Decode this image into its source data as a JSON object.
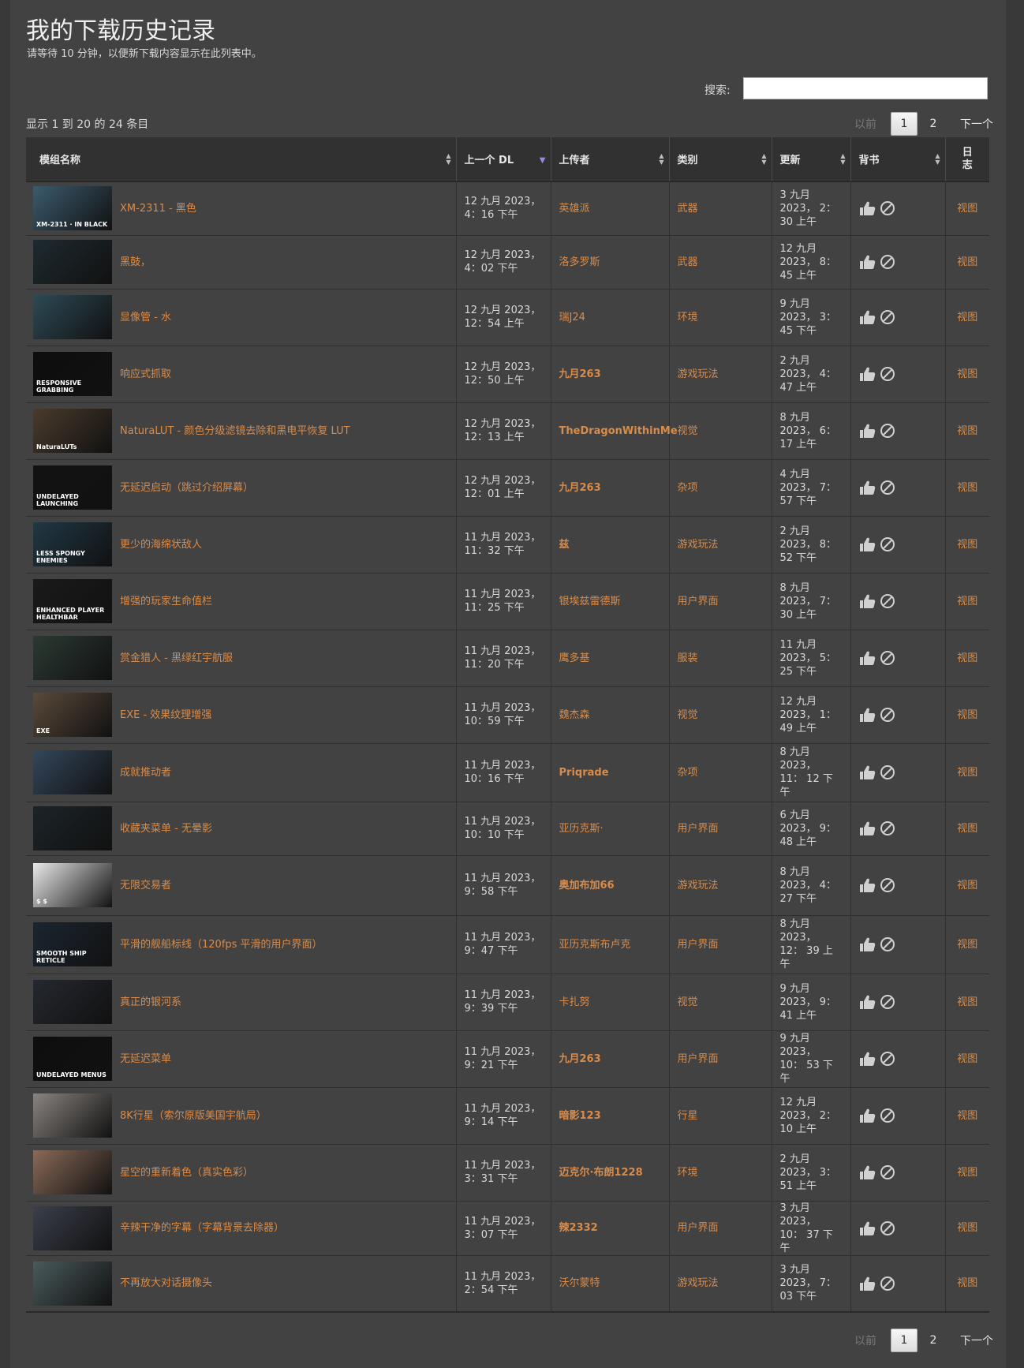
{
  "page": {
    "title": "我的下载历史记录",
    "subtitle": "请等待 10 分钟，以便新下载内容显示在此列表中。"
  },
  "search": {
    "label": "搜索:",
    "value": ""
  },
  "info": "显示 1 到 20 的 24 条目",
  "pagination": {
    "prev": "以前",
    "current": "1",
    "page2": "2",
    "next": "下一个"
  },
  "table": {
    "headers": {
      "mod": "模组名称",
      "last_dl": "上一个 DL",
      "uploader": "上传者",
      "category": "类别",
      "updated": "更新",
      "endorse": "背书",
      "log": "日志"
    },
    "rows": [
      {
        "name": "XM-2311 - 黑色",
        "dl": "12 九月 2023， 4：16 下午",
        "uploader": "英雄派",
        "category": "武器",
        "updated": "3 九月 2023， 2： 30 上午",
        "log": "视图",
        "thumb_color": "#3b5b6d",
        "thumb_text": "XM-2311 · IN BLACK",
        "uploader_bold": false
      },
      {
        "name": "黑鼓，",
        "dl": "12 九月 2023， 4：02 下午",
        "uploader": "洛多罗斯",
        "category": "武器",
        "updated": "12 九月 2023， 8： 45 上午",
        "log": "视图",
        "thumb_color": "#1e2a30",
        "thumb_text": "",
        "uploader_bold": false
      },
      {
        "name": "显像管 - 水",
        "dl": "12 九月 2023， 12：54 上午",
        "uploader": "瑞J24",
        "category": "环境",
        "updated": "9 九月 2023， 3： 45 下午",
        "log": "视图",
        "thumb_color": "#2d4a55",
        "thumb_text": "",
        "uploader_bold": false
      },
      {
        "name": "响应式抓取",
        "dl": "12 九月 2023， 12：50 上午",
        "uploader": "九月263",
        "category": "游戏玩法",
        "updated": "2 九月 2023， 4： 47 上午",
        "log": "视图",
        "thumb_color": "#0d0d0d",
        "thumb_text": "RESPONSIVE GRABBING",
        "uploader_bold": true
      },
      {
        "name": "NaturaLUT - 颜色分级滤镜去除和黑电平恢复 LUT",
        "dl": "12 九月 2023， 12：13 上午",
        "uploader": "TheDragonWithinMe",
        "category": "视觉",
        "updated": "8 九月 2023， 6： 17 上午",
        "log": "视图",
        "thumb_color": "#4a3b2c",
        "thumb_text": "NaturaLUTs",
        "uploader_bold": true
      },
      {
        "name": "无延迟启动（跳过介绍屏幕）",
        "dl": "12 九月 2023， 12：01 上午",
        "uploader": "九月263",
        "category": "杂项",
        "updated": "4 九月 2023， 7： 57 下午",
        "log": "视图",
        "thumb_color": "#121212",
        "thumb_text": "UNDELAYED LAUNCHING",
        "uploader_bold": true
      },
      {
        "name": "更少的海绵状敌人",
        "dl": "11 九月 2023， 11：32 下午",
        "uploader": "兹",
        "category": "游戏玩法",
        "updated": "2 九月 2023， 8： 52 下午",
        "log": "视图",
        "thumb_color": "#203845",
        "thumb_text": "LESS SPONGY ENEMIES",
        "uploader_bold": true
      },
      {
        "name": "增强的玩家生命值栏",
        "dl": "11 九月 2023， 11：25 下午",
        "uploader": "银埃兹雷德斯",
        "category": "用户界面",
        "updated": "8 九月 2023， 7： 30 上午",
        "log": "视图",
        "thumb_color": "#1a1a1a",
        "thumb_text": "ENHANCED PLAYER HEALTHBAR",
        "uploader_bold": false
      },
      {
        "name": "赏金猎人 - 黑绿红宇航服",
        "dl": "11 九月 2023， 11：20 下午",
        "uploader": "鹰多基",
        "category": "服装",
        "updated": "11 九月 2023， 5： 25 下午",
        "log": "视图",
        "thumb_color": "#2b3a33",
        "thumb_text": "",
        "uploader_bold": false
      },
      {
        "name": "EXE - 效果纹理增强",
        "dl": "11 九月 2023， 10：59 下午",
        "uploader": "魏杰森",
        "category": "视觉",
        "updated": "12 九月 2023， 1： 49 上午",
        "log": "视图",
        "thumb_color": "#5a4a3a",
        "thumb_text": "EXE",
        "uploader_bold": false
      },
      {
        "name": "成就推动者",
        "dl": "11 九月 2023， 10：16 下午",
        "uploader": "Priqrade",
        "category": "杂项",
        "updated": "8 九月 2023， 11： 12 下午",
        "log": "视图",
        "thumb_color": "#33475c",
        "thumb_text": "",
        "uploader_bold": true
      },
      {
        "name": "收藏夹菜单 - 无晕影",
        "dl": "11 九月 2023， 10：10 下午",
        "uploader": "亚历克斯·",
        "category": "用户界面",
        "updated": "6 九月 2023， 9： 48 上午",
        "log": "视图",
        "thumb_color": "#1c2429",
        "thumb_text": "",
        "uploader_bold": false
      },
      {
        "name": "无限交易者",
        "dl": "11 九月 2023， 9：58 下午",
        "uploader": "奥加布加66",
        "category": "游戏玩法",
        "updated": "8 九月 2023， 4： 27 下午",
        "log": "视图",
        "thumb_color": "#e9e9e9",
        "thumb_text": "$      $",
        "uploader_bold": true
      },
      {
        "name": "平滑的舰船标线（120fps 平滑的用户界面）",
        "dl": "11 九月 2023， 9：47 下午",
        "uploader": "亚历克斯布卢克",
        "category": "用户界面",
        "updated": "8 九月 2023， 12： 39 上午",
        "log": "视图",
        "thumb_color": "#1b2630",
        "thumb_text": "SMOOTH SHIP RETICLE",
        "uploader_bold": false
      },
      {
        "name": "真正的银河系",
        "dl": "11 九月 2023， 9：39 下午",
        "uploader": "卡扎努",
        "category": "视觉",
        "updated": "9 九月 2023， 9： 41 上午",
        "log": "视图",
        "thumb_color": "#252830",
        "thumb_text": "",
        "uploader_bold": false
      },
      {
        "name": "无延迟菜单",
        "dl": "11 九月 2023， 9：21 下午",
        "uploader": "九月263",
        "category": "用户界面",
        "updated": "9 九月 2023， 10： 53 下午",
        "log": "视图",
        "thumb_color": "#0e0e0e",
        "thumb_text": "UNDELAYED MENUS",
        "uploader_bold": true
      },
      {
        "name": "8K行星（索尔原版美国宇航局）",
        "dl": "11 九月 2023， 9：14 下午",
        "uploader": "暗影123",
        "category": "行星",
        "updated": "12 九月 2023， 2： 10 上午",
        "log": "视图",
        "thumb_color": "#8a8480",
        "thumb_text": "",
        "uploader_bold": true
      },
      {
        "name": "星空的重新着色（真实色彩）",
        "dl": "11 九月 2023， 3：31 下午",
        "uploader": "迈克尔·布朗1228",
        "category": "环境",
        "updated": "2 九月 2023， 3： 51 上午",
        "log": "视图",
        "thumb_color": "#8a6a58",
        "thumb_text": "",
        "uploader_bold": true
      },
      {
        "name": "辛辣干净的字幕（字幕背景去除器）",
        "dl": "11 九月 2023， 3：07 下午",
        "uploader": "辣2332",
        "category": "用户界面",
        "updated": "3 九月 2023， 10： 37 下午",
        "log": "视图",
        "thumb_color": "#3a3f4a",
        "thumb_text": "",
        "uploader_bold": true
      },
      {
        "name": "不再放大对话摄像头",
        "dl": "11 九月 2023， 2：54 下午",
        "uploader": "沃尔蒙特",
        "category": "游戏玩法",
        "updated": "3 九月 2023， 7： 03 下午",
        "log": "视图",
        "thumb_color": "#4a5a5c",
        "thumb_text": "",
        "uploader_bold": false
      }
    ]
  },
  "colors": {
    "link": "#d98c4a",
    "background": "#424242",
    "header": "#313131"
  },
  "icons": {
    "endorse": "thumbs-up-icon",
    "abstain": "no-entry-icon"
  }
}
